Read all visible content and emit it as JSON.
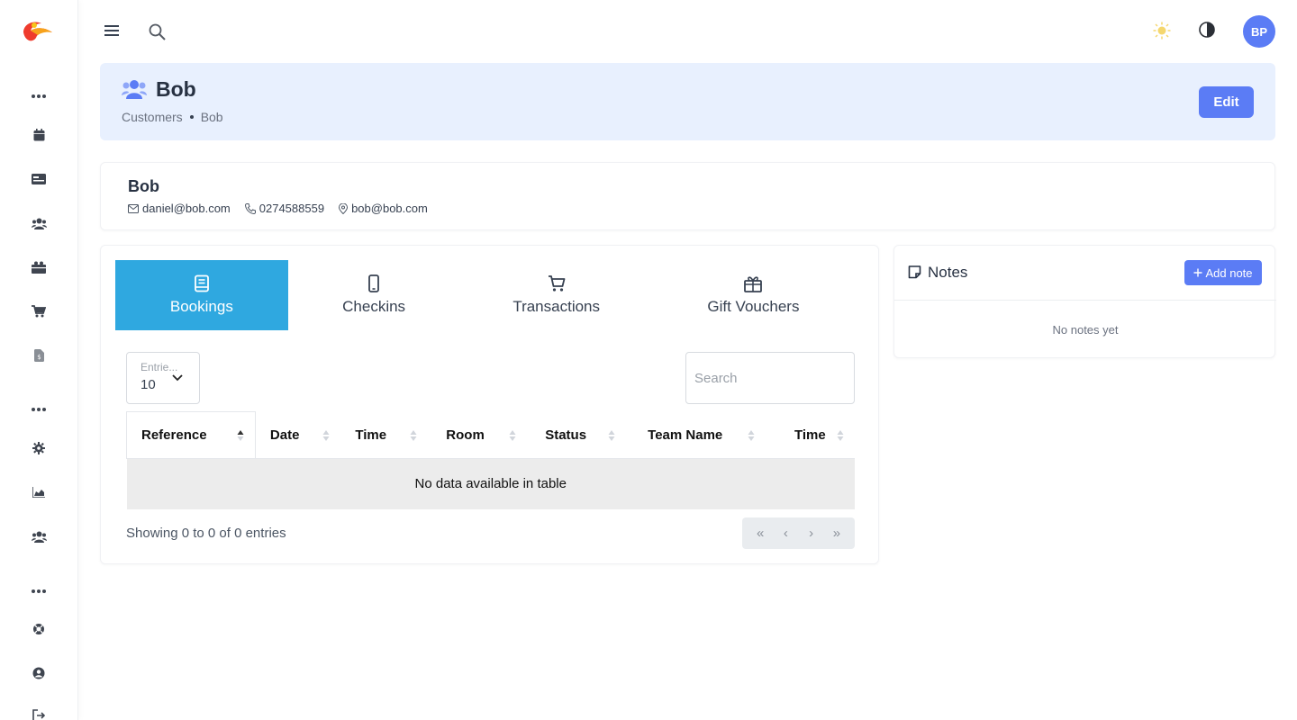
{
  "topbar": {
    "avatar_initials": "BP",
    "menu_icon": "hamburger-icon",
    "search_icon": "search-icon",
    "theme_icons": [
      "sun-icon",
      "contrast-icon"
    ]
  },
  "sidebar": {
    "items": [
      {
        "icon": "calendar-icon"
      },
      {
        "icon": "id-card-icon"
      },
      {
        "icon": "users-icon"
      },
      {
        "icon": "gift-icon"
      },
      {
        "icon": "cart-icon"
      },
      {
        "icon": "invoice-icon"
      },
      {
        "icon": "gear-icon"
      },
      {
        "icon": "chart-area-icon"
      },
      {
        "icon": "users-icon"
      },
      {
        "icon": "lifebuoy-icon"
      },
      {
        "icon": "user-circle-icon"
      },
      {
        "icon": "logout-icon"
      }
    ]
  },
  "header": {
    "title": "Bob",
    "breadcrumb": [
      "Customers",
      "Bob"
    ],
    "edit_label": "Edit"
  },
  "profile": {
    "name": "Bob",
    "email": "daniel@bob.com",
    "phone": "0274588559",
    "address": "bob@bob.com"
  },
  "tabs": [
    {
      "label": "Bookings",
      "icon": "book-icon",
      "active": true
    },
    {
      "label": "Checkins",
      "icon": "mobile-icon",
      "active": false
    },
    {
      "label": "Transactions",
      "icon": "cart-icon",
      "active": false
    },
    {
      "label": "Gift Vouchers",
      "icon": "gift-icon",
      "active": false
    }
  ],
  "table": {
    "entries_label": "Entrie...",
    "entries_value": "10",
    "search_placeholder": "Search",
    "columns": [
      "Reference",
      "Date",
      "Time",
      "Room",
      "Status",
      "Team Name",
      "Time"
    ],
    "empty_message": "No data available in table",
    "info": "Showing 0 to 0 of 0 entries",
    "pager": [
      "«",
      "‹",
      "›",
      "»"
    ]
  },
  "notes": {
    "title": "Notes",
    "add_label": "Add note",
    "empty": "No notes yet"
  },
  "colors": {
    "accent": "#5b7cf5",
    "tab_active": "#2fa8e0",
    "header_bg": "#e8f0fe"
  }
}
